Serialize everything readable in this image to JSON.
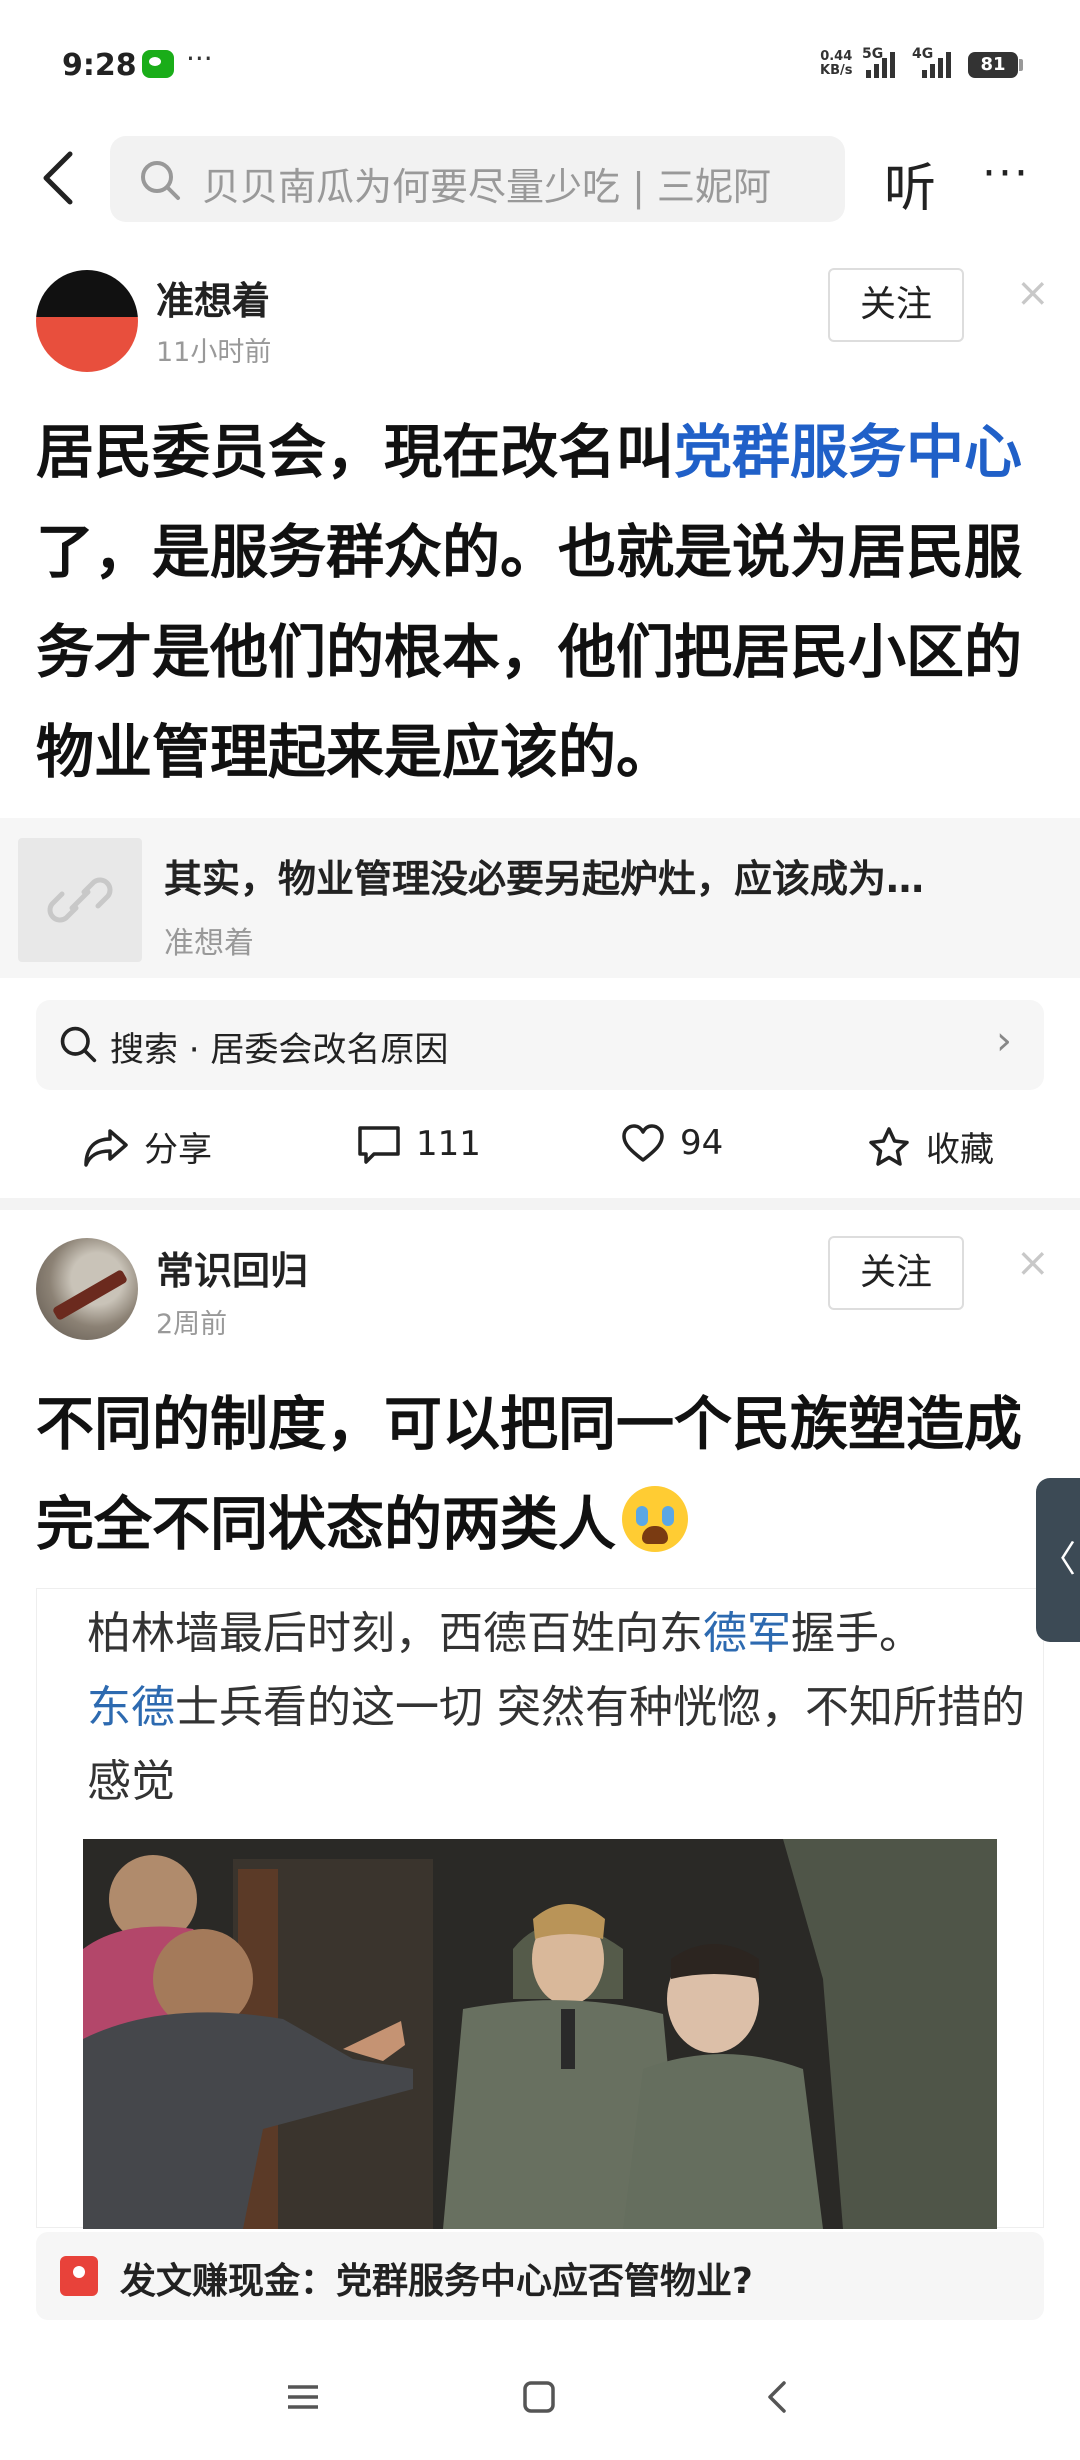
{
  "status_bar": {
    "time": "9:28",
    "more": "···",
    "net_speed_value": "0.44",
    "net_speed_unit": "KB/s",
    "gen1": "5G",
    "gen2": "4G",
    "battery": "81"
  },
  "top_nav": {
    "search_placeholder": "贝贝南瓜为何要尽量少吃 | 三妮阿",
    "listen_label": "听",
    "more_label": "···"
  },
  "post1": {
    "author": "准想着",
    "time": "11小时前",
    "follow_label": "关注",
    "close_label": "×",
    "text_part1": "居民委员会，現在改名叫",
    "text_highlight": "党群服务中心",
    "text_part2": "了，是服务群众的。也就是说为居民服务才是他们的根本，他们把居民小区的物业管理起来是应该的。",
    "link_card": {
      "title": "其实，物业管理没必要另起炉灶，应该成为…",
      "author": "准想着"
    },
    "search_suggest": "搜索 · 居委会改名原因",
    "actions": {
      "share": "分享",
      "comments": "111",
      "likes": "94",
      "favorite": "收藏"
    }
  },
  "post2": {
    "author": "常识回归",
    "time": "2周前",
    "follow_label": "关注",
    "close_label": "×",
    "text": "不同的制度，可以把同一个民族塑造成完全不同状态的两类人",
    "quote": {
      "line1_a": "柏林墙最后时刻，西德百姓向东",
      "line1_hl": "德军",
      "line1_b": "握手。",
      "line2_hl": "东德",
      "line2_b": "士兵看的这一切 突然有种恍惚，不知所措的感觉"
    }
  },
  "promo": {
    "text": "发文赚现金：党群服务中心应否管物业?"
  },
  "side_tab": "〈",
  "colors": {
    "link_blue": "#2060c8",
    "quote_blue": "#2d6ab0",
    "promo_red": "#e8423a"
  }
}
